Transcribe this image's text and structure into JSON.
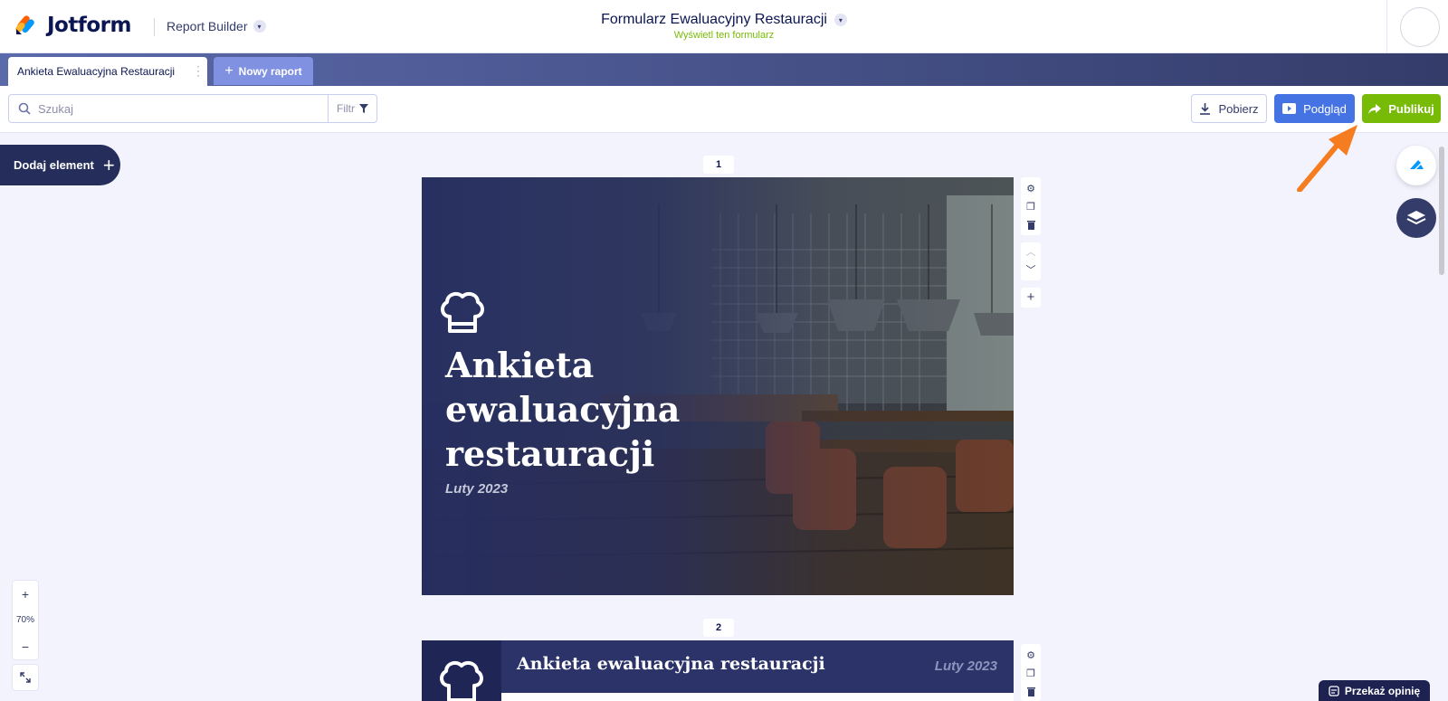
{
  "header": {
    "logo_text": "Jotform",
    "app_name": "Report Builder",
    "form_title": "Formularz Ewaluacyjny Restauracji",
    "form_subtitle": "Wyświetl ten formularz"
  },
  "tabs": {
    "active_label": "Ankieta Ewaluacyjna Restauracji",
    "new_label": "Nowy raport"
  },
  "toolbar": {
    "search_placeholder": "Szukaj",
    "filter_label": "Filtr",
    "download_label": "Pobierz",
    "preview_label": "Podgląd",
    "publish_label": "Publikuj"
  },
  "canvas": {
    "add_element_label": "Dodaj element",
    "pages": [
      {
        "number": "1",
        "title_lines": [
          "Ankieta",
          "ewaluacyjna",
          "restauracji"
        ],
        "date": "Luty 2023"
      },
      {
        "number": "2",
        "title": "Ankieta ewaluacyjna restauracji",
        "date": "Luty 2023"
      }
    ]
  },
  "zoom": {
    "level": "70%",
    "plus": "+",
    "minus": "−"
  },
  "feedback_label": "Przekaż opinię",
  "colors": {
    "brand_navy": "#0a1551",
    "publish_green": "#78bb07",
    "preview_blue": "#4573e3",
    "annotation_arrow": "#f57c1f"
  },
  "icons": {
    "search": "search-icon",
    "filter": "filter-icon",
    "download": "download-icon",
    "preview": "play-icon",
    "publish": "share-arrow-icon",
    "settings": "gear-icon",
    "duplicate": "copy-icon",
    "delete": "trash-icon",
    "move_up": "chevron-up-icon",
    "move_down": "chevron-down-icon",
    "add_page": "plus-icon",
    "layers": "layers-icon",
    "fullscreen": "expand-icon",
    "chef": "chef-hat-icon"
  }
}
